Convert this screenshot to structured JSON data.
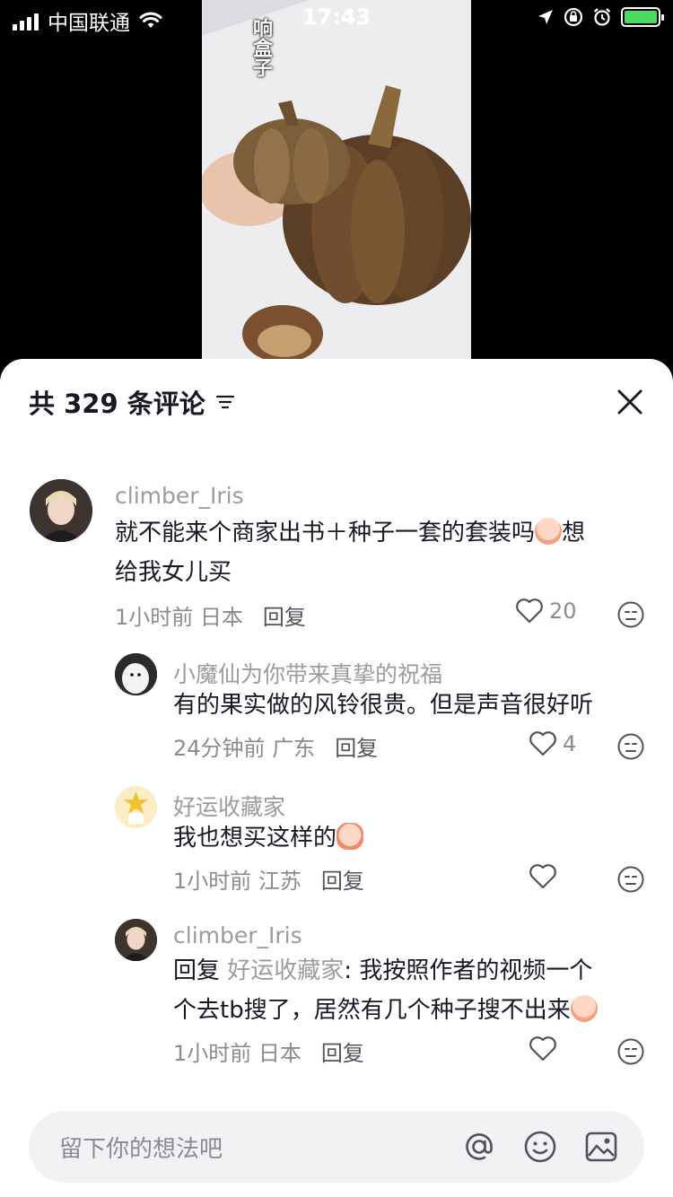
{
  "status_bar": {
    "carrier": "中国联通",
    "time": "17:43",
    "icons": [
      "signal-icon",
      "wifi-icon",
      "location-icon",
      "orientation-lock-icon",
      "alarm-icon",
      "battery-charging-icon"
    ]
  },
  "video": {
    "caption": "响盒子"
  },
  "panel": {
    "title": "共 329 条评论",
    "sort_icon": "sort-icon",
    "close_icon": "close-icon"
  },
  "comments": [
    {
      "user": "climber_Iris",
      "text_line1": "就不能来个商家出书＋种子一套的套装吗",
      "text_line1_tail": "想",
      "text_line2": "给我女儿买",
      "time": "1小时前",
      "location": "日本",
      "reply_label": "回复",
      "likes": "20"
    },
    {
      "user": "小魔仙为你带来真挚的祝福",
      "text_line1": "有的果实做的风铃很贵。但是声音很好听",
      "time": "24分钟前",
      "location": "广东",
      "reply_label": "回复",
      "likes": "4"
    },
    {
      "user": "好运收藏家",
      "text_line1": "我也想买这样的",
      "time": "1小时前",
      "location": "江苏",
      "reply_label": "回复",
      "likes": ""
    },
    {
      "user": "climber_Iris",
      "reply_prefix": "回复",
      "reply_to": "好运收藏家",
      "text_line1": ": 我按照作者的视频一个",
      "text_line2": "个去tb搜了，居然有几个种子搜不出来",
      "time": "1小时前",
      "location": "日本",
      "reply_label": "回复",
      "likes": ""
    }
  ],
  "input_bar": {
    "placeholder": "留下你的想法吧",
    "icons": [
      "at-icon",
      "emoji-icon",
      "image-icon"
    ]
  },
  "colors": {
    "accent_text": "#161823",
    "muted_text": "#8a8b91",
    "battery": "#4cd964"
  }
}
